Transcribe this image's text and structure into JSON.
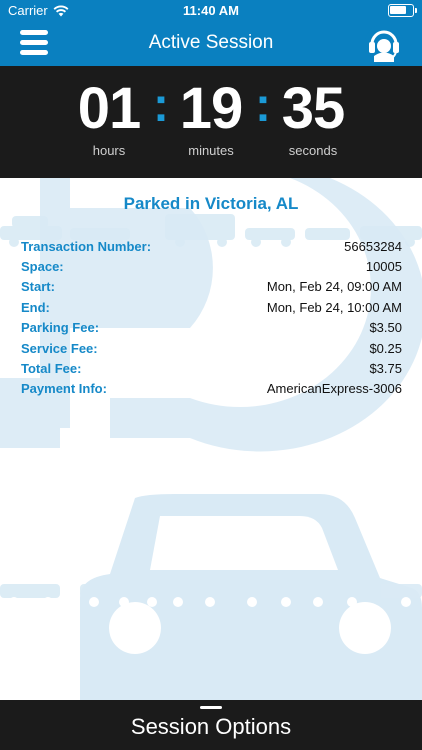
{
  "status_bar": {
    "carrier": "Carrier",
    "time": "11:40 AM",
    "battery_level": 0.75
  },
  "nav": {
    "title": "Active Session",
    "menu_icon": "menu-icon",
    "support_icon": "headset-icon"
  },
  "timer": {
    "hours": "01",
    "minutes": "19",
    "seconds": "35",
    "hours_label": "hours",
    "minutes_label": "minutes",
    "seconds_label": "seconds"
  },
  "session": {
    "location": "Parked in Victoria, AL",
    "rows": [
      {
        "label": "Transaction Number:",
        "value": "56653284"
      },
      {
        "label": "Space:",
        "value": "10005"
      },
      {
        "label": "Start:",
        "value": "Mon, Feb 24, 09:00 AM"
      },
      {
        "label": "End:",
        "value": "Mon, Feb 24, 10:00 AM"
      },
      {
        "label": "Parking Fee:",
        "value": "$3.50"
      },
      {
        "label": "Service Fee:",
        "value": "$0.25"
      },
      {
        "label": "Total Fee:",
        "value": "$3.75"
      },
      {
        "label": "Payment Info:",
        "value": "AmericanExpress-3006"
      }
    ]
  },
  "footer": {
    "label": "Session Options"
  },
  "colors": {
    "brand_blue": "#0a80c0",
    "accent_blue": "#1689c8",
    "dark": "#1b1b1b",
    "art": "#d9eaf5"
  }
}
